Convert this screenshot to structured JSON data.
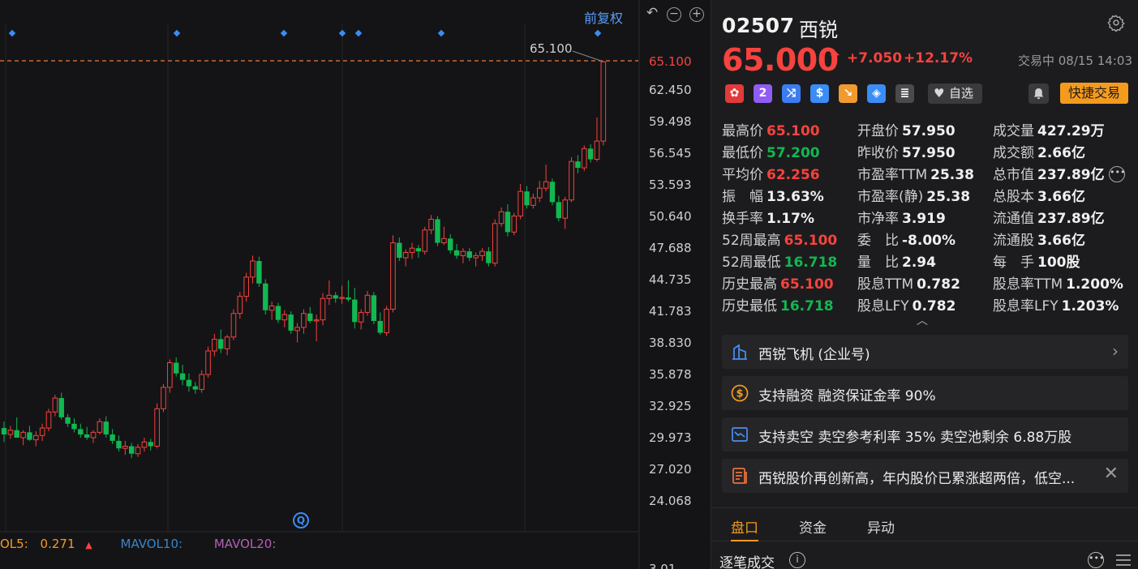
{
  "chart": {
    "restore_label": "前复权",
    "price_ticks": [
      "65.100",
      "62.450",
      "59.498",
      "56.545",
      "53.593",
      "50.640",
      "47.688",
      "44.735",
      "41.783",
      "38.830",
      "35.878",
      "32.925",
      "29.973",
      "27.020",
      "24.068"
    ],
    "volume_tick": "3.01",
    "high_marker": "65.100",
    "mavol": {
      "vol5_label": "OL5:",
      "vol5_value": "0.271",
      "vol10_label": "MAVOL10:",
      "vol20_label": "MAVOL20:"
    },
    "colors": {
      "up": "#f6433e",
      "down": "#12b751",
      "marker": "#3b8cf5"
    }
  },
  "chart_data": {
    "type": "candlestick",
    "ylim": [
      24.068,
      65.1
    ],
    "yticks": [
      65.1,
      62.45,
      59.498,
      56.545,
      53.593,
      50.64,
      47.688,
      44.735,
      41.783,
      38.83,
      35.878,
      32.925,
      29.973,
      27.02,
      24.068
    ],
    "annotations": [
      "65.100"
    ],
    "candles": [
      [
        30.8,
        31.4,
        29.5,
        30.2
      ],
      [
        30.2,
        31.0,
        29.8,
        30.6
      ],
      [
        30.6,
        31.8,
        30.0,
        29.9
      ],
      [
        29.9,
        30.6,
        29.2,
        30.4
      ],
      [
        30.4,
        31.0,
        29.6,
        29.7
      ],
      [
        29.7,
        30.5,
        29.1,
        30.1
      ],
      [
        30.1,
        31.2,
        29.6,
        30.8
      ],
      [
        30.8,
        32.6,
        30.5,
        32.3
      ],
      [
        32.3,
        33.9,
        31.9,
        33.6
      ],
      [
        33.6,
        34.1,
        31.6,
        31.8
      ],
      [
        31.8,
        32.1,
        30.9,
        31.2
      ],
      [
        31.2,
        31.7,
        30.4,
        30.7
      ],
      [
        30.7,
        31.2,
        29.9,
        30.2
      ],
      [
        30.2,
        30.9,
        29.7,
        29.9
      ],
      [
        29.9,
        30.6,
        29.4,
        30.4
      ],
      [
        30.4,
        31.7,
        30.2,
        31.4
      ],
      [
        31.4,
        31.9,
        29.9,
        30.2
      ],
      [
        30.2,
        30.7,
        29.3,
        29.6
      ],
      [
        29.6,
        30.1,
        28.6,
        28.9
      ],
      [
        28.9,
        29.6,
        28.3,
        29.1
      ],
      [
        29.1,
        29.4,
        28.0,
        28.4
      ],
      [
        28.4,
        29.3,
        28.1,
        29.0
      ],
      [
        29.0,
        29.9,
        28.6,
        29.5
      ],
      [
        29.5,
        29.8,
        28.7,
        29.1
      ],
      [
        29.1,
        33.1,
        28.9,
        32.6
      ],
      [
        32.6,
        34.9,
        32.3,
        34.6
      ],
      [
        34.6,
        37.2,
        34.1,
        36.9
      ],
      [
        36.9,
        37.4,
        35.6,
        35.9
      ],
      [
        35.9,
        36.7,
        34.8,
        35.3
      ],
      [
        35.3,
        35.9,
        34.2,
        34.7
      ],
      [
        34.7,
        35.1,
        34.0,
        34.4
      ],
      [
        34.4,
        36.2,
        34.1,
        35.8
      ],
      [
        35.8,
        38.4,
        35.5,
        38.0
      ],
      [
        38.0,
        39.6,
        37.5,
        39.1
      ],
      [
        39.1,
        40.0,
        37.8,
        38.2
      ],
      [
        38.2,
        39.5,
        37.6,
        39.3
      ],
      [
        39.3,
        41.9,
        39.0,
        41.5
      ],
      [
        41.5,
        43.5,
        41.0,
        43.1
      ],
      [
        43.1,
        45.3,
        42.6,
        44.9
      ],
      [
        44.9,
        46.9,
        44.3,
        46.4
      ],
      [
        46.4,
        46.8,
        44.0,
        44.3
      ],
      [
        44.3,
        44.7,
        41.4,
        41.8
      ],
      [
        41.8,
        42.6,
        40.9,
        42.2
      ],
      [
        42.2,
        42.5,
        40.6,
        40.9
      ],
      [
        40.9,
        41.8,
        40.2,
        41.4
      ],
      [
        41.4,
        41.7,
        39.6,
        39.9
      ],
      [
        39.9,
        40.6,
        38.8,
        40.2
      ],
      [
        40.2,
        41.9,
        39.6,
        41.5
      ],
      [
        41.5,
        42.1,
        40.6,
        40.8
      ],
      [
        40.8,
        41.4,
        38.9,
        40.9
      ],
      [
        40.9,
        43.4,
        40.4,
        42.9
      ],
      [
        42.9,
        44.6,
        42.3,
        43.2
      ],
      [
        43.2,
        43.5,
        42.5,
        42.9
      ],
      [
        42.9,
        44.1,
        42.4,
        43.0
      ],
      [
        43.0,
        44.6,
        42.6,
        42.8
      ],
      [
        42.8,
        43.9,
        40.1,
        40.7
      ],
      [
        40.7,
        41.9,
        40.0,
        41.6
      ],
      [
        41.6,
        43.6,
        41.3,
        43.2
      ],
      [
        43.2,
        43.5,
        40.5,
        40.8
      ],
      [
        40.8,
        41.6,
        39.5,
        39.7
      ],
      [
        39.7,
        42.2,
        39.4,
        41.9
      ],
      [
        41.9,
        48.8,
        41.6,
        48.1
      ],
      [
        48.1,
        48.6,
        46.4,
        46.7
      ],
      [
        46.7,
        47.5,
        45.9,
        47.2
      ],
      [
        47.2,
        48.1,
        46.6,
        47.6
      ],
      [
        47.6,
        47.9,
        46.7,
        47.3
      ],
      [
        47.3,
        49.6,
        47.0,
        49.3
      ],
      [
        49.3,
        50.7,
        48.9,
        50.3
      ],
      [
        50.3,
        50.6,
        47.8,
        48.1
      ],
      [
        48.1,
        49.6,
        47.9,
        48.5
      ],
      [
        48.5,
        48.9,
        47.1,
        47.4
      ],
      [
        47.4,
        48.0,
        46.6,
        46.9
      ],
      [
        46.9,
        47.6,
        46.2,
        47.3
      ],
      [
        47.3,
        47.6,
        46.4,
        46.7
      ],
      [
        46.7,
        47.2,
        45.9,
        46.9
      ],
      [
        46.9,
        47.6,
        46.4,
        47.3
      ],
      [
        47.3,
        47.7,
        45.9,
        46.2
      ],
      [
        46.2,
        50.3,
        45.9,
        49.9
      ],
      [
        49.9,
        51.4,
        49.6,
        51.0
      ],
      [
        51.0,
        51.7,
        48.7,
        49.1
      ],
      [
        49.1,
        50.9,
        48.8,
        50.6
      ],
      [
        50.6,
        53.6,
        50.3,
        52.9
      ],
      [
        52.9,
        53.4,
        51.3,
        51.6
      ],
      [
        51.6,
        52.7,
        51.3,
        52.3
      ],
      [
        52.3,
        53.9,
        51.9,
        53.2
      ],
      [
        53.2,
        55.4,
        52.9,
        53.8
      ],
      [
        53.8,
        54.1,
        51.6,
        51.9
      ],
      [
        51.9,
        52.5,
        50.1,
        50.4
      ],
      [
        50.4,
        52.4,
        49.4,
        52.1
      ],
      [
        52.1,
        56.1,
        51.9,
        55.7
      ],
      [
        55.7,
        56.3,
        54.6,
        55.1
      ],
      [
        55.1,
        57.2,
        54.8,
        56.9
      ],
      [
        56.9,
        57.3,
        55.6,
        55.9
      ],
      [
        55.9,
        59.8,
        55.7,
        57.6
      ],
      [
        57.6,
        65.1,
        57.2,
        65.0
      ]
    ]
  },
  "header": {
    "code": "02507",
    "name": "西锐",
    "price": "65.000",
    "change": "+7.050",
    "change_pct": "+12.17%",
    "status": "交易中 08/15 14:03",
    "watch_label": "自选",
    "quick_trade_label": "快捷交易"
  },
  "stats": [
    [
      [
        "最高价",
        "65.100",
        "red"
      ],
      [
        "开盘价",
        "57.950",
        "white"
      ],
      [
        "成交量",
        "427.29万",
        "white"
      ]
    ],
    [
      [
        "最低价",
        "57.200",
        "green"
      ],
      [
        "昨收价",
        "57.950",
        "white"
      ],
      [
        "成交额",
        "2.66亿",
        "white"
      ]
    ],
    [
      [
        "平均价",
        "62.256",
        "red"
      ],
      [
        "市盈率TTM",
        "25.38",
        "white"
      ],
      [
        "总市值",
        "237.89亿",
        "white"
      ]
    ],
    [
      [
        "振　幅",
        "13.63%",
        "white"
      ],
      [
        "市盈率(静)",
        "25.38",
        "white"
      ],
      [
        "总股本",
        "3.66亿",
        "white"
      ]
    ],
    [
      [
        "换手率",
        "1.17%",
        "white"
      ],
      [
        "市净率",
        "3.919",
        "white"
      ],
      [
        "流通值",
        "237.89亿",
        "white"
      ]
    ],
    [
      [
        "52周最高",
        "65.100",
        "red"
      ],
      [
        "委　比",
        "-8.00%",
        "white"
      ],
      [
        "流通股",
        "3.66亿",
        "white"
      ]
    ],
    [
      [
        "52周最低",
        "16.718",
        "green"
      ],
      [
        "量　比",
        "2.94",
        "white"
      ],
      [
        "每　手",
        "100股",
        "white"
      ]
    ],
    [
      [
        "历史最高",
        "65.100",
        "red"
      ],
      [
        "股息TTM",
        "0.782",
        "white"
      ],
      [
        "股息率TTM",
        "1.200%",
        "white"
      ]
    ],
    [
      [
        "历史最低",
        "16.718",
        "green"
      ],
      [
        "股息LFY",
        "0.782",
        "white"
      ],
      [
        "股息率LFY",
        "1.203%",
        "white"
      ]
    ]
  ],
  "cards": {
    "company": "西锐飞机 (企业号)",
    "margin": "支持融资 融资保证金率 90%",
    "short": "支持卖空 卖空参考利率 35% 卖空池剩余 6.88万股",
    "news": "西锐股价再创新高，年内股价已累涨超两倍，低空..."
  },
  "tabs": [
    "盘口",
    "资金",
    "异动"
  ],
  "trades_label": "逐笔成交"
}
